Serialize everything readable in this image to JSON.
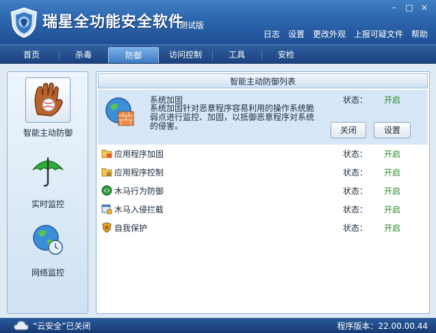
{
  "app": {
    "title": "瑞星全功能安全软件",
    "badge": "测试版",
    "window_controls": [
      "–",
      "□",
      "×"
    ],
    "top_links": [
      "日志",
      "设置",
      "更改外观",
      "上报可疑文件",
      "帮助"
    ]
  },
  "nav": {
    "tabs": [
      "首页",
      "杀毒",
      "防御",
      "访问控制",
      "工具",
      "安检"
    ],
    "active_index": 2
  },
  "sidebar": {
    "items": [
      {
        "label": "智能主动防御",
        "icon": "baseball-glove-icon"
      },
      {
        "label": "实时监控",
        "icon": "umbrella-icon"
      },
      {
        "label": "网络监控",
        "icon": "globe-clock-icon"
      }
    ],
    "selected_index": 0
  },
  "main": {
    "header": "智能主动防御列表",
    "featured": {
      "name": "系统加固",
      "description": "系统加固针对恶意程序容易利用的操作系统脆弱点进行监控、加固，以抵御恶意程序对系统的侵害。",
      "status_label": "状态：",
      "status_value": "开启",
      "close_button": "关闭",
      "settings_button": "设置"
    },
    "rows": [
      {
        "name": "应用程序加固",
        "status_label": "状态：",
        "status_value": "开启",
        "icon": "folder-app-icon"
      },
      {
        "name": "应用程序控制",
        "status_label": "状态：",
        "status_value": "开启",
        "icon": "folder-gear-icon"
      },
      {
        "name": "木马行为防御",
        "status_label": "状态：",
        "status_value": "开启",
        "icon": "green-shield-icon"
      },
      {
        "name": "木马入侵拦截",
        "status_label": "状态：",
        "status_value": "开启",
        "icon": "window-lock-icon"
      },
      {
        "name": "自我保护",
        "status_label": "状态：",
        "status_value": "开启",
        "icon": "lion-shield-icon"
      }
    ]
  },
  "statusbar": {
    "cloud_text": "“云安全”已关闭",
    "version_text": "程序版本：22.00.00.44"
  },
  "colors": {
    "title_bar": "#2c65ad",
    "status_on": "#2b8a2b",
    "featured_bg": "#d7e7f7"
  }
}
